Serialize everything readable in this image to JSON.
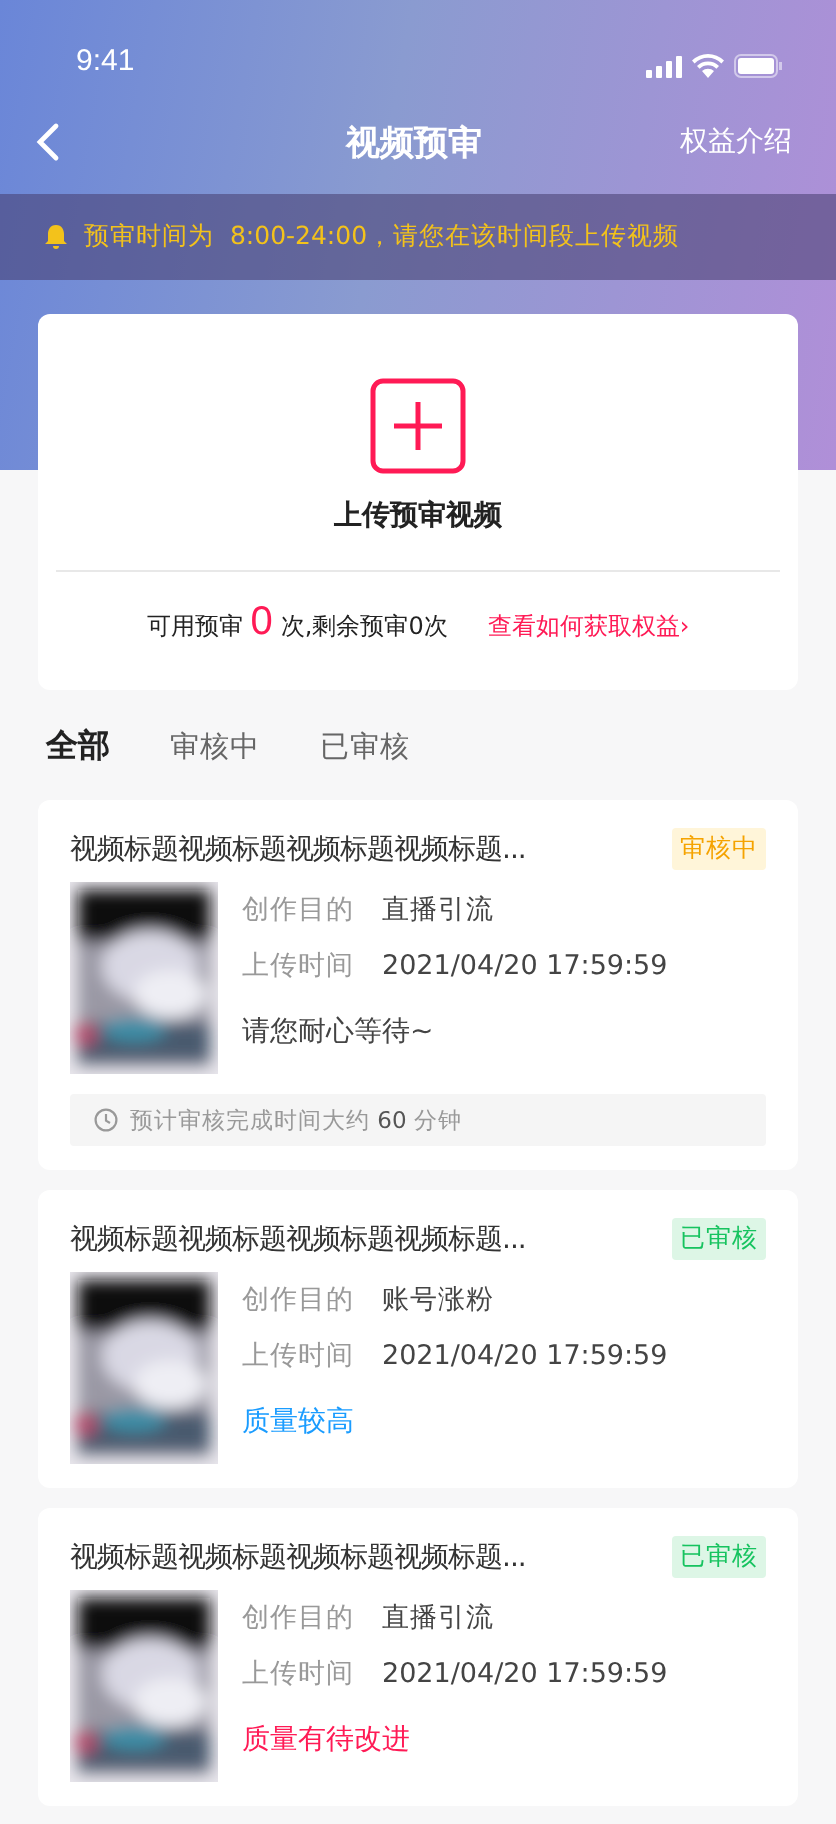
{
  "status_bar": {
    "time": "9:41"
  },
  "nav": {
    "title": "视频预审",
    "action": "权益介绍"
  },
  "notice": {
    "text": "预审时间为  8:00-24:00，请您在该时间段上传视频"
  },
  "upload": {
    "label": "上传预审视频",
    "quota_prefix": "可用预审",
    "quota_count": "0",
    "quota_suffix": "次,剩余预审0次",
    "link": "查看如何获取权益",
    "link_arrow": "›"
  },
  "tabs": [
    {
      "label": "全部",
      "selected": true
    },
    {
      "label": "审核中",
      "selected": false
    },
    {
      "label": "已审核",
      "selected": false
    }
  ],
  "videos": [
    {
      "title": "视频标题视频标题视频标题视频标题...",
      "status": {
        "text": "审核中",
        "kind": "reviewing"
      },
      "purpose_label": "创作目的",
      "purpose": "直播引流",
      "time_label": "上传时间",
      "time": "2021/04/20 17:59:59",
      "result": {
        "text": "请您耐心等待~",
        "kind": "note"
      },
      "eta": {
        "prefix": "预计审核完成时间大约",
        "value": "60",
        "unit": "分钟"
      }
    },
    {
      "title": "视频标题视频标题视频标题视频标题...",
      "status": {
        "text": "已审核",
        "kind": "reviewed"
      },
      "purpose_label": "创作目的",
      "purpose": "账号涨粉",
      "time_label": "上传时间",
      "time": "2021/04/20 17:59:59",
      "result": {
        "text": "质量较高",
        "kind": "good"
      }
    },
    {
      "title": "视频标题视频标题视频标题视频标题...",
      "status": {
        "text": "已审核",
        "kind": "reviewed"
      },
      "purpose_label": "创作目的",
      "purpose": "直播引流",
      "time_label": "上传时间",
      "time": "2021/04/20 17:59:59",
      "result": {
        "text": "质量有待改进",
        "kind": "bad"
      }
    }
  ]
}
